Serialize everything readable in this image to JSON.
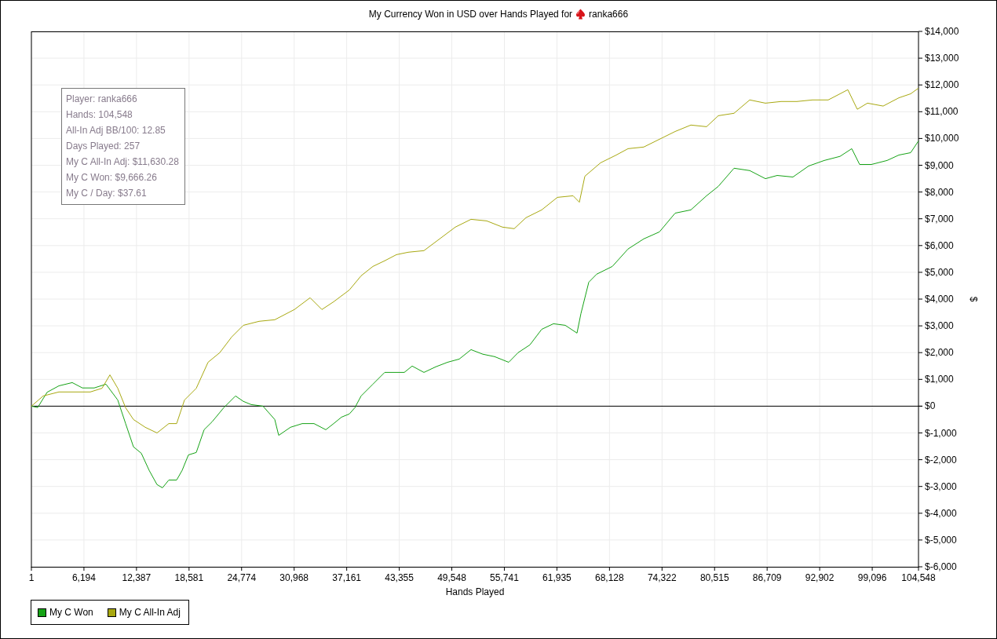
{
  "title": {
    "text": "My Currency Won in USD over Hands Played for",
    "player": "ranka666"
  },
  "info_box": [
    "Player: ranka666",
    "Hands: 104,548",
    "All-In Adj BB/100: 12.85",
    "Days Played: 257",
    "My C All-In Adj: $11,630.28",
    "My C Won: $9,666.26",
    "My C / Day: $37.61"
  ],
  "chart_data": {
    "type": "line",
    "xlabel": "Hands Played",
    "ylabel": "$",
    "grid": true,
    "xlim": [
      1,
      104548
    ],
    "ylim": [
      -6000,
      14000
    ],
    "xticks": [
      {
        "value": 1,
        "label": "1"
      },
      {
        "value": 6194,
        "label": "6,194"
      },
      {
        "value": 12387,
        "label": "12,387"
      },
      {
        "value": 18581,
        "label": "18,581"
      },
      {
        "value": 24774,
        "label": "24,774"
      },
      {
        "value": 30968,
        "label": "30,968"
      },
      {
        "value": 37161,
        "label": "37,161"
      },
      {
        "value": 43355,
        "label": "43,355"
      },
      {
        "value": 49548,
        "label": "49,548"
      },
      {
        "value": 55741,
        "label": "55,741"
      },
      {
        "value": 61935,
        "label": "61,935"
      },
      {
        "value": 68128,
        "label": "68,128"
      },
      {
        "value": 74322,
        "label": "74,322"
      },
      {
        "value": 80515,
        "label": "80,515"
      },
      {
        "value": 86709,
        "label": "86,709"
      },
      {
        "value": 92902,
        "label": "92,902"
      },
      {
        "value": 99096,
        "label": "99,096"
      },
      {
        "value": 104548,
        "label": "104,548"
      }
    ],
    "yticks": [
      {
        "value": 14000,
        "label": "$14,000"
      },
      {
        "value": 13000,
        "label": "$13,000"
      },
      {
        "value": 12000,
        "label": "$12,000"
      },
      {
        "value": 11000,
        "label": "$11,000"
      },
      {
        "value": 10000,
        "label": "$10,000"
      },
      {
        "value": 9000,
        "label": "$9,000"
      },
      {
        "value": 8000,
        "label": "$8,000"
      },
      {
        "value": 7000,
        "label": "$7,000"
      },
      {
        "value": 6000,
        "label": "$6,000"
      },
      {
        "value": 5000,
        "label": "$5,000"
      },
      {
        "value": 4000,
        "label": "$4,000"
      },
      {
        "value": 3000,
        "label": "$3,000"
      },
      {
        "value": 2000,
        "label": "$2,000"
      },
      {
        "value": 1000,
        "label": "$1,000"
      },
      {
        "value": 0,
        "label": "$0"
      },
      {
        "value": -1000,
        "label": "$-1,000"
      },
      {
        "value": -2000,
        "label": "$-2,000"
      },
      {
        "value": -3000,
        "label": "$-3,000"
      },
      {
        "value": -4000,
        "label": "$-4,000"
      },
      {
        "value": -5000,
        "label": "$-5,000"
      },
      {
        "value": -6000,
        "label": "$-6,000"
      }
    ],
    "series": [
      {
        "name": "My C Won",
        "color": "#16a316",
        "x": [
          1,
          740,
          1850,
          3238,
          4811,
          6014,
          7402,
          8789,
          10177,
          11102,
          12028,
          12953,
          13878,
          14804,
          15451,
          16191,
          17116,
          17764,
          18504,
          19429,
          20355,
          21280,
          22667,
          24055,
          24980,
          25906,
          27293,
          28681,
          29144,
          30532,
          31919,
          33307,
          34695,
          35620,
          36545,
          37471,
          38118,
          38858,
          40246,
          41634,
          43021,
          43947,
          44872,
          46260,
          47648,
          49036,
          50423,
          51811,
          53199,
          54587,
          56252,
          57362,
          58750,
          60138,
          61526,
          62914,
          64301,
          64764,
          65689,
          66614,
          68465,
          70315,
          72166,
          74016,
          75866,
          77717,
          79567,
          80955,
          82805,
          84656,
          86506,
          87894,
          89744,
          91595,
          93445,
          95296,
          96683,
          97609,
          98996,
          100847,
          102234,
          103622,
          104548
        ],
        "values": [
          0,
          -50,
          520,
          760,
          880,
          680,
          680,
          820,
          230,
          -650,
          -1520,
          -1760,
          -2400,
          -2930,
          -3050,
          -2760,
          -2760,
          -2400,
          -1820,
          -1730,
          -880,
          -590,
          -60,
          380,
          180,
          60,
          0,
          -500,
          -1090,
          -790,
          -650,
          -650,
          -880,
          -650,
          -410,
          -290,
          -60,
          380,
          820,
          1260,
          1260,
          1260,
          1500,
          1260,
          1470,
          1640,
          1760,
          2110,
          1940,
          1850,
          1640,
          2000,
          2290,
          2870,
          3080,
          3020,
          2730,
          3460,
          4630,
          4930,
          5220,
          5870,
          6250,
          6510,
          7210,
          7330,
          7860,
          8210,
          8890,
          8800,
          8500,
          8620,
          8560,
          8970,
          9180,
          9330,
          9620,
          9030,
          9030,
          9180,
          9380,
          9470,
          9910
        ]
      },
      {
        "name": "My C All-In Adj",
        "color": "#a8a810",
        "x": [
          1,
          1388,
          3238,
          5089,
          6939,
          8327,
          9252,
          10177,
          11102,
          12028,
          13415,
          14804,
          16191,
          17116,
          18041,
          19429,
          20817,
          22205,
          23593,
          24980,
          26831,
          28681,
          30994,
          32845,
          34232,
          35620,
          37471,
          38858,
          40246,
          41634,
          43021,
          44410,
          46260,
          48110,
          49961,
          51811,
          53662,
          55512,
          56900,
          58288,
          60138,
          61988,
          63839,
          64579,
          65227,
          67077,
          68927,
          70315,
          72166,
          74016,
          75866,
          77717,
          79567,
          80955,
          82805,
          84656,
          86506,
          88357,
          90207,
          92057,
          93908,
          96221,
          97331,
          98534,
          100384,
          102234,
          103622,
          104548
        ],
        "values": [
          0,
          380,
          530,
          530,
          530,
          670,
          1170,
          670,
          -60,
          -500,
          -790,
          -1000,
          -650,
          -650,
          230,
          670,
          1640,
          2000,
          2580,
          3020,
          3170,
          3230,
          3610,
          4050,
          3610,
          3900,
          4340,
          4870,
          5220,
          5430,
          5660,
          5750,
          5810,
          6250,
          6690,
          6980,
          6920,
          6690,
          6630,
          7040,
          7330,
          7800,
          7860,
          7620,
          8590,
          9090,
          9380,
          9620,
          9680,
          9970,
          10260,
          10500,
          10440,
          10850,
          10940,
          11440,
          11320,
          11380,
          11380,
          11440,
          11440,
          11820,
          11090,
          11320,
          11210,
          11520,
          11670,
          11880
        ]
      }
    ]
  }
}
